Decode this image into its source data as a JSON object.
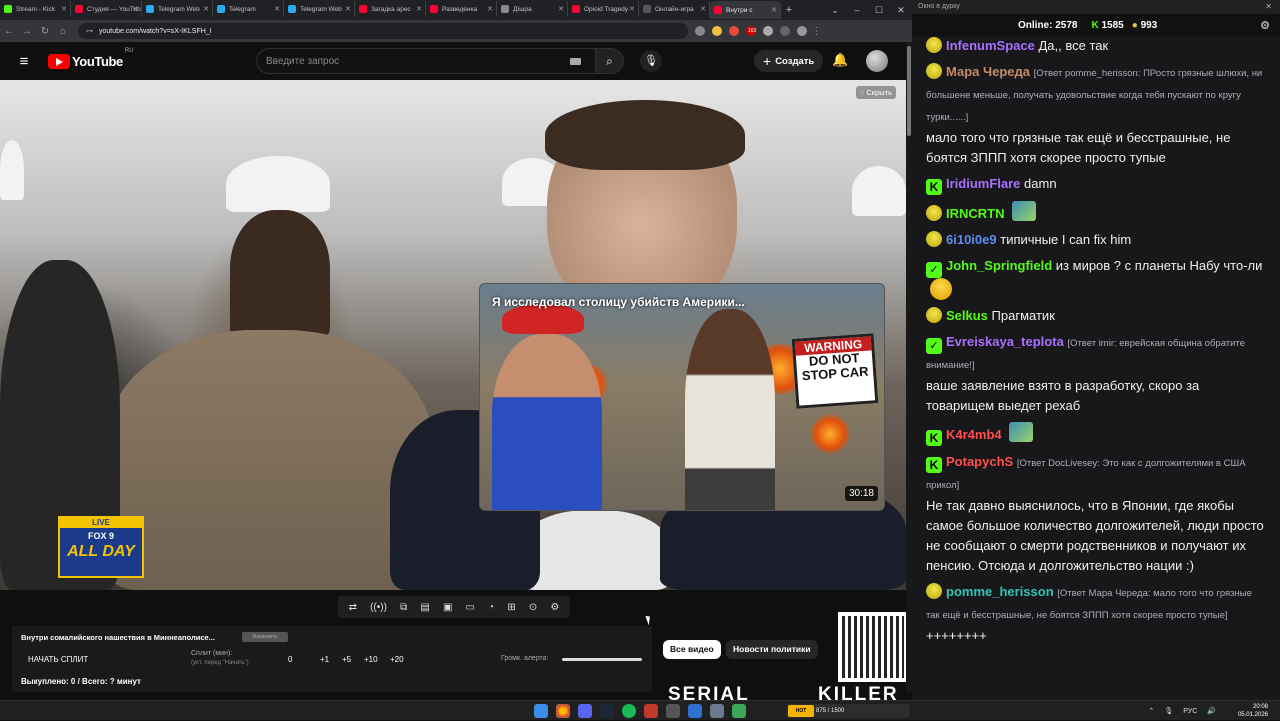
{
  "browser": {
    "tabs": [
      {
        "label": "Stream - Kick",
        "color": "#53fc18"
      },
      {
        "label": "Студия — YouTube",
        "color": "#ff0033"
      },
      {
        "label": "Telegram Web",
        "color": "#2aabee"
      },
      {
        "label": "Telegram",
        "color": "#2aabee"
      },
      {
        "label": "Telegram Web",
        "color": "#2aabee"
      },
      {
        "label": "Загадка арес",
        "color": "#ff0033"
      },
      {
        "label": "Разведенка",
        "color": "#ff0033"
      },
      {
        "label": "Дїшра",
        "color": "#888888"
      },
      {
        "label": "Opioid Tragedy",
        "color": "#ff0033"
      },
      {
        "label": "Онлайн-игра",
        "color": "#555555"
      },
      {
        "label": "Внутри с",
        "color": "#ff0033",
        "active": true
      }
    ],
    "url": "youtube.com/watch?v=sX-IKLSFH_I",
    "ext_badge": "163"
  },
  "youtube": {
    "logo_text": "YouTube",
    "logo_region": "RU",
    "search_placeholder": "Введите запрос",
    "create_label": "Создать",
    "hide_label": "Скрыть",
    "live_badge": "LIVE",
    "fox_label": "FOX 9",
    "allday_label": "ALL DAY"
  },
  "suggestion_card": {
    "title": "Я исследовал столицу убийств Америки...",
    "duration": "30:18",
    "sign_warning": "WARNING",
    "sign_text": "DO NOT STOP CAR"
  },
  "split_panel": {
    "title": "Внутри сомалийского нашествия в Миннеаполисе...",
    "small_button": "Изменить",
    "start_label": "НАЧАТЬ СПЛИТ",
    "split_label": "Сплит (мин):",
    "split_sub": "(уст. перед \"Начать\")",
    "split_value": "0",
    "increments": [
      "+1",
      "+5",
      "+10",
      "+20"
    ],
    "volume_label": "Громк. алерта:",
    "volume_level": 1.0,
    "bought_label": "Выкуплено: 0 / Всего: ? минут"
  },
  "chips": {
    "all_videos": "Все видео",
    "politics": "Новости политики"
  },
  "bottom_promo": {
    "serial": "SERIAL",
    "killer": "KILLER"
  },
  "chat": {
    "window_title": "Окно в дурку",
    "online_label": "Online:",
    "online_count": "2578",
    "kick_count": "1585",
    "coin_count": "993",
    "messages": [
      {
        "user": "InfenumSpace",
        "color": "#a970ff",
        "badge": "smile",
        "text": "Да,, все так",
        "reply": ""
      },
      {
        "user": "Мара Череда",
        "color": "#c58a6a",
        "badge": "smile",
        "reply": "[Ответ pomme_herisson: ПРосто грязные шлюхи, ни большене меньше, получать удовольствие когда тебя пускают по кругу турки......]",
        "text": "мало того что грязные так ещё и бесстрашные, не боятся ЗППП хотя скорее просто тупые"
      },
      {
        "user": "IridiumFlare",
        "color": "#a970ff",
        "badge": "k",
        "text": "damn",
        "reply": ""
      },
      {
        "user": "IRNCRTN",
        "color": "#53fc18",
        "badge": "smile",
        "text": "",
        "reply": ""
      },
      {
        "user": "6i10i0e9",
        "color": "#5b8def",
        "badge": "smile",
        "text": "типичные I can fix him",
        "reply": ""
      },
      {
        "user": "John_Springfield",
        "color": "#53fc18",
        "badge": "check",
        "text": "из миров ? с планеты Набу что-ли",
        "reply": ""
      },
      {
        "user": "Selkus",
        "color": "#53fc18",
        "badge": "smile",
        "text": "Прагматик",
        "reply": ""
      },
      {
        "user": "Evreiskaya_teplota",
        "color": "#a970ff",
        "badge": "check",
        "reply": "[Ответ imir: еврейская община обратите внимание!]",
        "text": "ваше заявление взято в разработку, скоро за товарищем выедет рехаб"
      },
      {
        "user": "K4r4mb4",
        "color": "#ff4f4f",
        "badge": "k",
        "text": "",
        "reply": ""
      },
      {
        "user": "PotapychS",
        "color": "#ff4f4f",
        "badge": "k",
        "reply": "[Ответ DocLivesey: Это как с долгожителями в США прикол]",
        "text": "Не так давно выяснилось, что в Японии, где якобы самое большое количество долгожителей, люди просто не сообщают о смерти родственников и получают их пенсию. Отсюда и долгожительство нации :)"
      },
      {
        "user": "pomme_herisson",
        "color": "#2ec4b6",
        "badge": "smile",
        "reply": "[Ответ Мара Череда: мало того что грязные так ещё и бесстрашные, не боятся ЗППП хотя скорее просто тупые]",
        "text": "++++++++"
      }
    ]
  },
  "taskbar": {
    "widget_label": "875 / 1500",
    "widget_badge": "HOT",
    "lang": "РУС",
    "time": "20:08",
    "date": "05.01.2026"
  }
}
